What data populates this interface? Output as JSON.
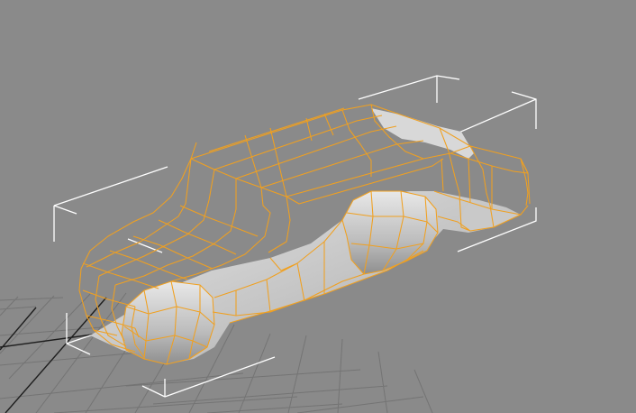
{
  "viewport": {
    "view": "perspective",
    "background_color": "#8a8a8a",
    "grid_color": "#747474",
    "grid_axis_color": "#1e1e1e",
    "selection_bracket_color": "#ffffff",
    "wireframe_color": "#f0a020",
    "surface_color": "#c6c6c6",
    "object": {
      "display": "wireframe-on-shaded",
      "selected": true
    }
  }
}
